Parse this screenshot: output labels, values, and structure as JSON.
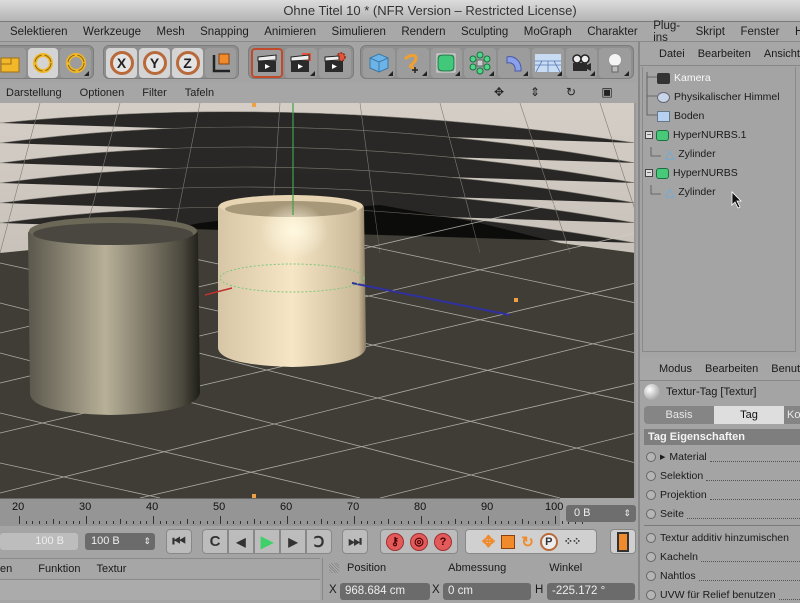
{
  "window": {
    "title": "Ohne Titel 10 * (NFR Version – Restricted License)"
  },
  "menubar": {
    "items": [
      "Selektieren",
      "Werkzeuge",
      "Mesh",
      "Snapping",
      "Animieren",
      "Simulieren",
      "Rendern",
      "Sculpting",
      "MoGraph",
      "Charakter",
      "Plug-ins",
      "Skript",
      "Fenster",
      "Hilfe"
    ]
  },
  "toolbar": {
    "axis_buttons": [
      "X",
      "Y",
      "Z"
    ],
    "icons": [
      "scale-icon",
      "rotate-icon",
      "rotate-alt-icon",
      "x-axis-lock-icon",
      "y-axis-lock-icon",
      "z-axis-lock-icon",
      "coordinate-system-icon",
      "render-view-icon",
      "render-picture-viewer-icon",
      "render-settings-icon",
      "cube-icon",
      "spline-pen-icon",
      "subdivision-surface-icon",
      "cloner-icon",
      "deformer-bend-icon",
      "floor-scene-icon",
      "camera-icon",
      "light-icon"
    ]
  },
  "viewport": {
    "menu": [
      "Darstellung",
      "Optionen",
      "Filter",
      "Tafeln"
    ],
    "nav_icons": [
      "move-view-icon",
      "zoom-view-icon",
      "rotate-view-icon",
      "maximize-view-icon"
    ],
    "colors": {
      "floor": "#3f3d35",
      "sky": "#cfc9c1",
      "cylinder_selected": "#e8d8b8",
      "cylinder_other": "#8e8a7a",
      "y_axis": "#3fa04a",
      "z_axis": "#3030a0",
      "x_axis": "#c03030"
    }
  },
  "timeline": {
    "ticks": [
      "20",
      "30",
      "40",
      "50",
      "60",
      "70",
      "80",
      "90",
      "100"
    ],
    "current_frame": "0 B"
  },
  "transport": {
    "start_field": "100 B",
    "end_field": "100 B",
    "accent_play": "#3fd06a"
  },
  "material_panel": {
    "menu": [
      "en",
      "Funktion",
      "Textur"
    ]
  },
  "coordinates": {
    "headers": [
      "Position",
      "Abmessung",
      "Winkel"
    ],
    "rows": [
      {
        "pos_label": "X",
        "pos_value": "968.684 cm",
        "size_label": "X",
        "size_value": "0 cm",
        "rot_label": "H",
        "rot_value": "-225.172 °"
      }
    ]
  },
  "object_manager": {
    "menu": [
      "Datei",
      "Bearbeiten",
      "Ansicht"
    ],
    "items": [
      {
        "label": "Kamera",
        "icon": "camera-icon",
        "level": 0,
        "selected": true
      },
      {
        "label": "Physikalischer Himmel",
        "icon": "sky-icon",
        "level": 0
      },
      {
        "label": "Boden",
        "icon": "floor-icon",
        "level": 0
      },
      {
        "label": "HyperNURBS.1",
        "icon": "hypernurbs-icon",
        "level": 0,
        "expanded": true
      },
      {
        "label": "Zylinder",
        "icon": "cylinder-icon",
        "level": 1
      },
      {
        "label": "HyperNURBS",
        "icon": "hypernurbs-icon",
        "level": 0,
        "expanded": true
      },
      {
        "label": "Zylinder",
        "icon": "cylinder-icon",
        "level": 1
      }
    ]
  },
  "attribute_manager": {
    "menu": [
      "Modus",
      "Bearbeiten",
      "Benutzer"
    ],
    "title": "Textur-Tag [Textur]",
    "tabs": [
      {
        "label": "Basis",
        "active": false
      },
      {
        "label": "Tag",
        "active": true
      },
      {
        "label": "Ko",
        "active": false
      }
    ],
    "section": "Tag Eigenschaften",
    "group1": [
      "Material",
      "Selektion",
      "Projektion",
      "Seite"
    ],
    "group2": [
      "Textur additiv hinzumischen",
      "Kacheln",
      "Nahtlos",
      "UVW für Relief benutzen"
    ]
  }
}
